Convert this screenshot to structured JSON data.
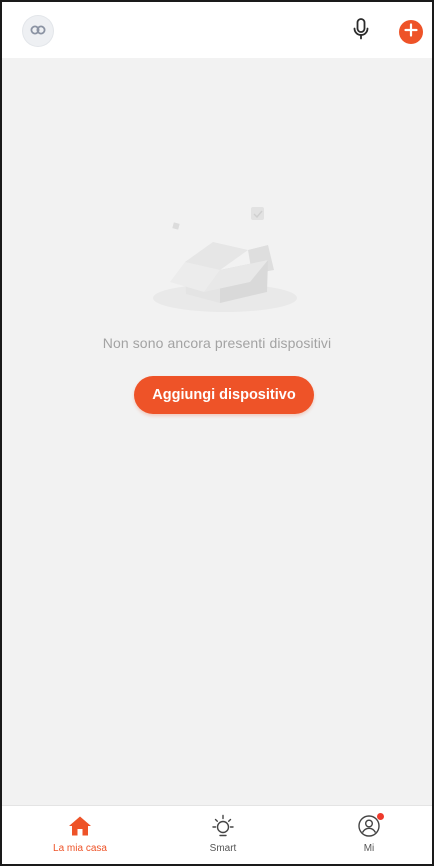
{
  "header": {
    "avatar_icon": "account-avatar-icon",
    "mic_icon": "microphone-icon",
    "add_icon": "plus-icon"
  },
  "empty_state": {
    "illustration": "empty-box-icon",
    "message": "Non sono ancora presenti dispositivi",
    "add_button_label": "Aggiungi dispositivo"
  },
  "tabs": [
    {
      "label": "La mia casa",
      "icon": "home-icon",
      "active": true
    },
    {
      "label": "Smart",
      "icon": "sun-icon",
      "active": false
    },
    {
      "label": "Mi",
      "icon": "user-icon",
      "active": false,
      "badge": true
    }
  ],
  "colors": {
    "accent": "#ee5328",
    "background": "#f2f2f2",
    "text_muted": "#a3a3a3"
  }
}
